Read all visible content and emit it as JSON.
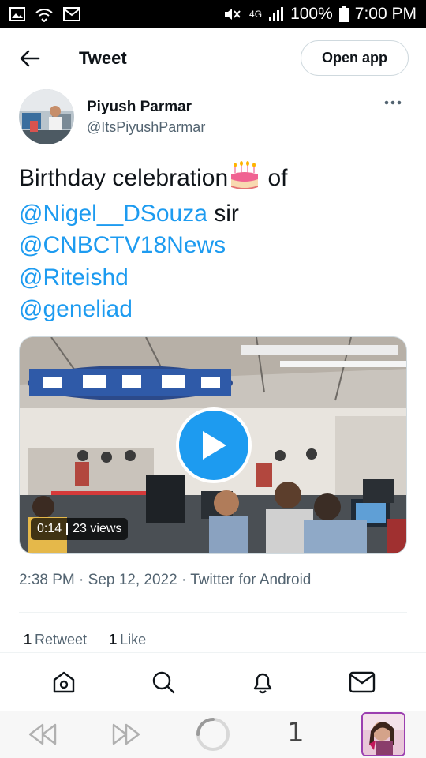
{
  "status_bar": {
    "network": "4G",
    "battery": "100%",
    "time": "7:00 PM"
  },
  "header": {
    "title": "Tweet",
    "open_app_label": "Open app"
  },
  "tweet": {
    "author_name": "Piyush Parmar",
    "author_handle": "@ItsPiyushParmar",
    "text_1": "Birthday celebration",
    "text_2": " of",
    "mention_1": "@Nigel__DSouza",
    "text_3": " sir",
    "mention_2": "@CNBCTV18News",
    "mention_3": "@Riteishd",
    "mention_4": "@geneliad",
    "video_duration": "0:14",
    "video_views": "23 views",
    "timestamp": "2:38 PM · Sep 12, 2022 · Twitter for Android",
    "retweet_count": "1",
    "retweet_label": "Retweet",
    "like_count": "1",
    "like_label": "Like"
  },
  "browser": {
    "tab_count": "1"
  },
  "icons": {
    "back": "back-arrow-icon",
    "more": "more-horizontal-icon",
    "home": "home-icon",
    "search": "search-icon",
    "notifications": "bell-icon",
    "messages": "mail-icon",
    "play": "play-icon",
    "browser_back": "rewind-icon",
    "browser_forward": "fast-forward-icon",
    "reload": "loading-spinner-icon"
  },
  "colors": {
    "accent": "#1d9bf0",
    "text": "#0f1419",
    "secondary": "#536471"
  }
}
